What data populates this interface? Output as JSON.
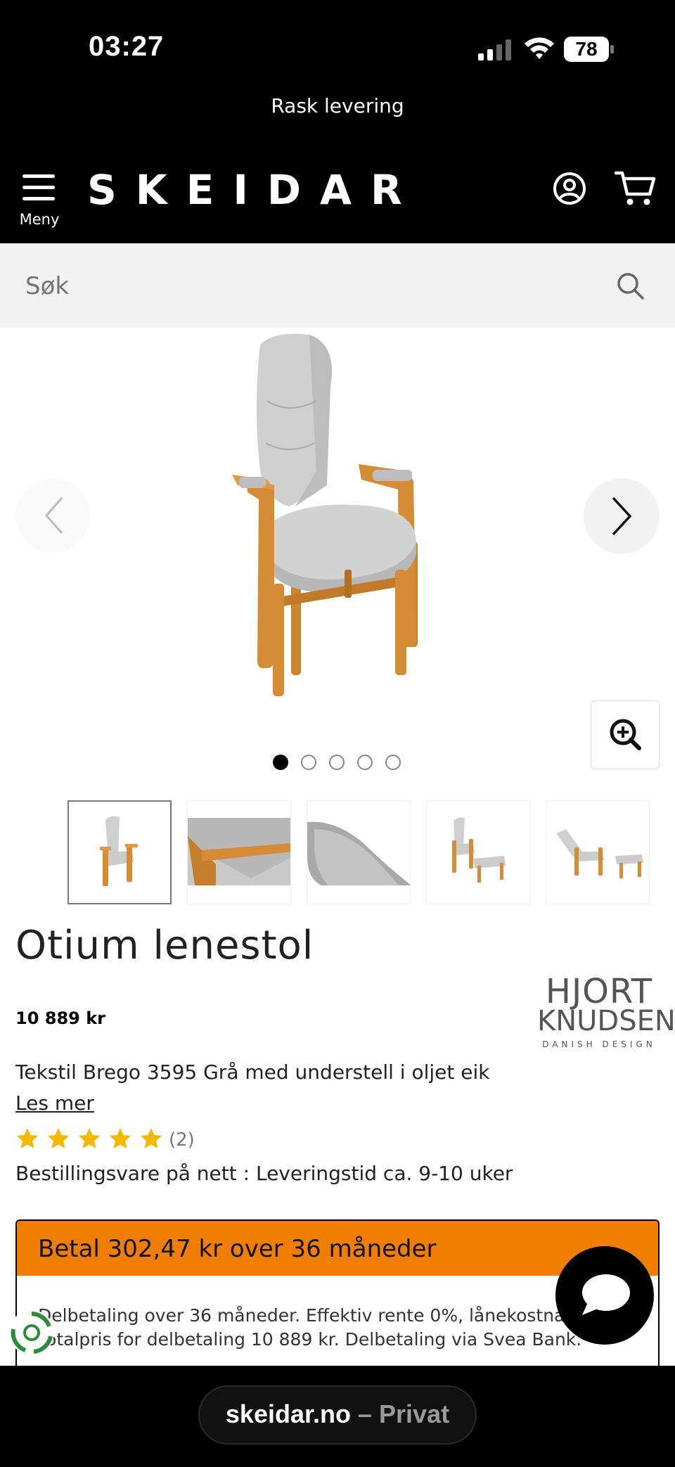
{
  "status_bar": {
    "time": "03:27",
    "battery": "78"
  },
  "promo": {
    "text": "Rask levering"
  },
  "header": {
    "menu_label": "Meny",
    "logo_text": "SKEIDAR",
    "user_icon": "user-circle-icon",
    "cart_icon": "cart-icon"
  },
  "search": {
    "placeholder": "Søk",
    "value": ""
  },
  "gallery": {
    "image_count": 5,
    "active_index": 0,
    "thumbnails": [
      "front view",
      "armrest detail",
      "headrest detail",
      "chair with footstool",
      "reclined with footstool"
    ]
  },
  "product": {
    "title": "Otium lenestol",
    "price": "10 889 kr",
    "brand": {
      "line1": "HJORT",
      "line2": "KNUDSEN",
      "line3": "DANISH DESIGN"
    },
    "variant": "Tekstil Brego 3595 Grå med understell i oljet eik",
    "read_more": "Les mer",
    "rating": 5,
    "review_count": "(2)",
    "delivery": "Bestillingsvare på nett : Leveringstid ca. 9-10 uker"
  },
  "finance": {
    "title": "Betal 302,47 kr over 36 måneder",
    "line1": "Delbetaling over 36 måneder. Effektiv rente 0%, lånekostnad",
    "line2": "Totalpris for delbetaling 10 889 kr. Delbetaling via Svea Bank."
  },
  "browser": {
    "domain": "skeidar.no",
    "separator": " – ",
    "mode": "Privat"
  },
  "colors": {
    "accent": "#f07e00",
    "header_bg": "#000000",
    "search_bg": "#f2f2f2",
    "star": "#f5b800"
  }
}
